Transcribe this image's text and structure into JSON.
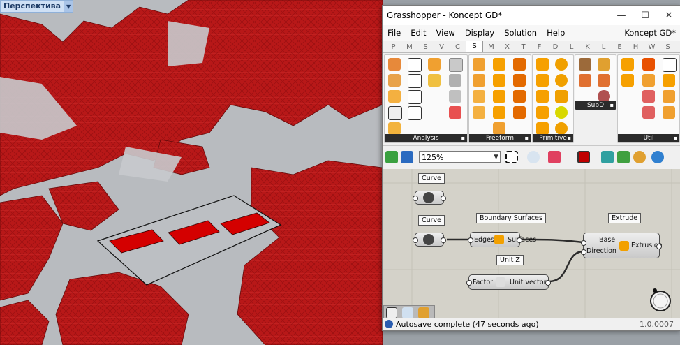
{
  "viewport": {
    "label": "Перспектива"
  },
  "grasshopper": {
    "title": "Grasshopper - Koncept GD*",
    "window_buttons": [
      "—",
      "☐",
      "✕"
    ],
    "menu": [
      "File",
      "Edit",
      "View",
      "Display",
      "Solution",
      "Help"
    ],
    "document_name": "Koncept GD*",
    "tabs": [
      "P",
      "M",
      "S",
      "V",
      "C",
      "S",
      "M",
      "X",
      "T",
      "F",
      "D",
      "L",
      "K",
      "L",
      "E",
      "H",
      "W",
      "S"
    ],
    "active_tab": "S",
    "panels": [
      {
        "name": "Analysis"
      },
      {
        "name": "Freeform"
      },
      {
        "name": "Primitive"
      },
      {
        "name": "SubD"
      },
      {
        "name": "Util"
      }
    ],
    "zoom": "125%",
    "components": {
      "curve1": {
        "label": "Curve"
      },
      "curve2": {
        "label": "Curve"
      },
      "boundary": {
        "label": "Boundary Surfaces",
        "input": "Edges",
        "output": "Surfaces"
      },
      "unitz": {
        "label": "Unit Z",
        "input": "Factor",
        "output": "Unit vector"
      },
      "extrude": {
        "label": "Extrude",
        "input1": "Base",
        "input2": "Direction",
        "output": "Extrusion"
      }
    },
    "status": {
      "message": "Autosave complete (47 seconds ago)",
      "version": "1.0.0007"
    }
  },
  "colors": {
    "accent_red": "#d40000",
    "panel_footer": "#2b2b2b",
    "canvas_bg": "#d4d2c9"
  }
}
